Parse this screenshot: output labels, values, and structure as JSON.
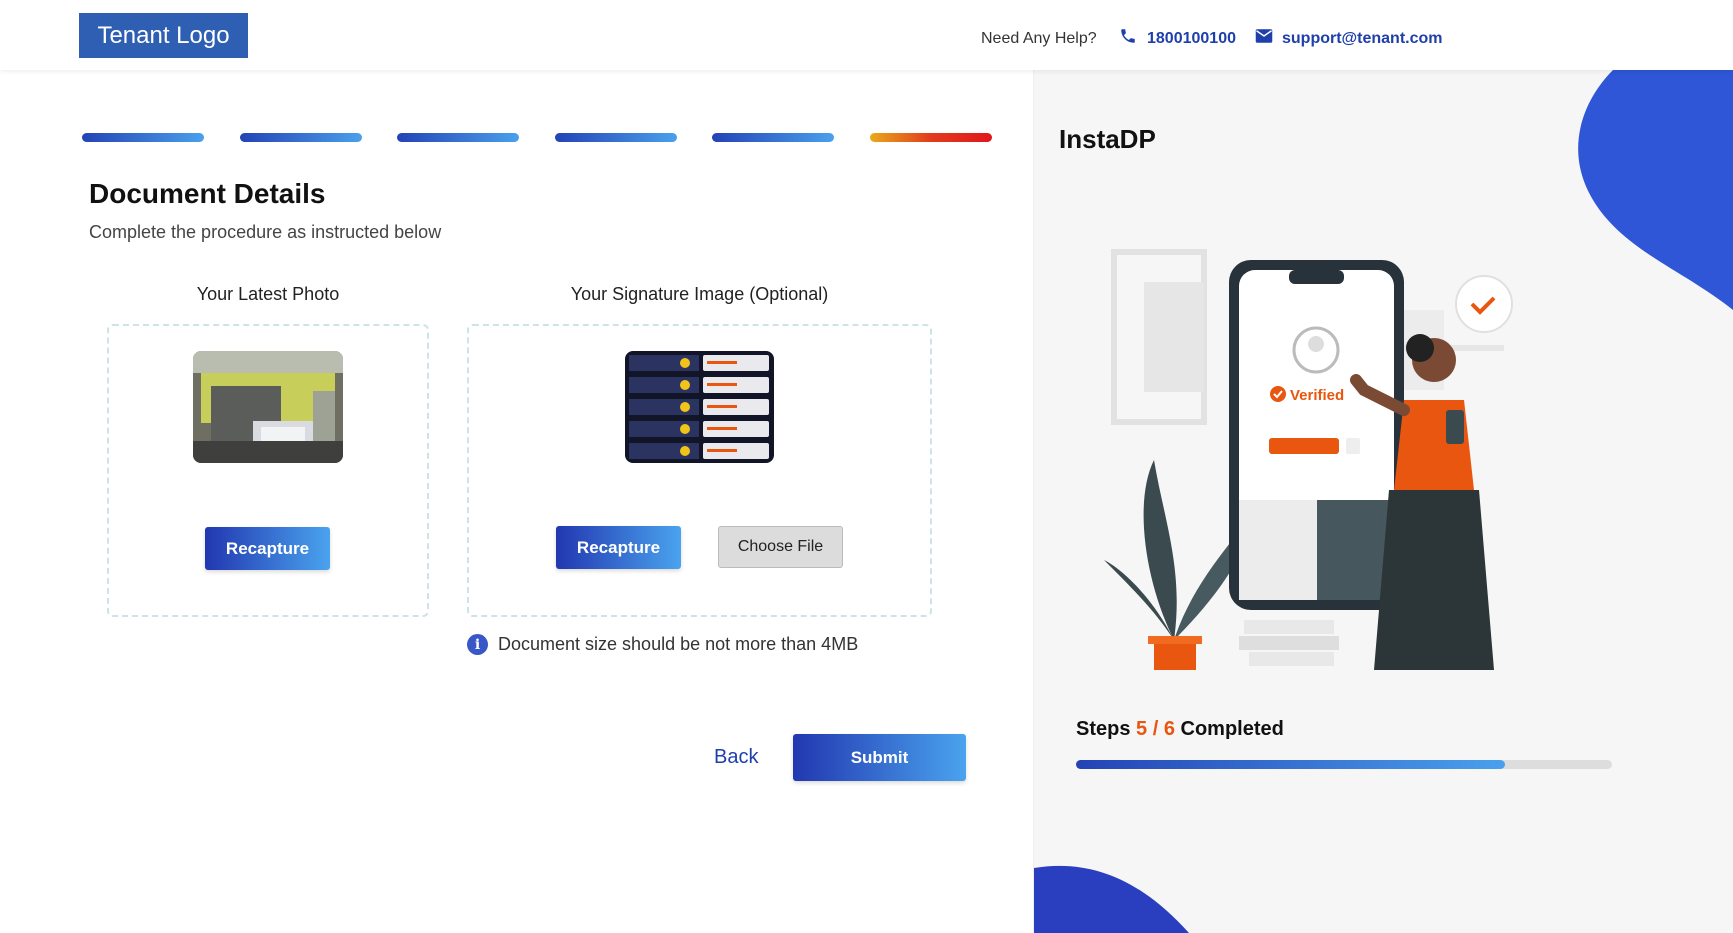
{
  "header": {
    "logo_text": "Tenant Logo",
    "help_text": "Need Any Help?",
    "phone": "1800100100",
    "email": "support@tenant.com",
    "phone_icon": "phone-icon",
    "email_icon": "mail-icon"
  },
  "stepper": {
    "total": 6,
    "current": 6
  },
  "form": {
    "title": "Document Details",
    "subtitle": "Complete the procedure as instructed below",
    "photo": {
      "label": "Your Latest Photo",
      "recapture_label": "Recapture"
    },
    "signature": {
      "label": "Your Signature Image (Optional)",
      "recapture_label": "Recapture",
      "choose_file_label": "Choose File"
    },
    "note": "Document size should be not more than 4MB",
    "back_label": "Back",
    "submit_label": "Submit"
  },
  "side_panel": {
    "app_name": "InstaDP",
    "verified_text": "Verified",
    "steps_prefix": "Steps",
    "steps_value": "5 / 6",
    "steps_suffix": "Completed",
    "progress_fraction": 0.8
  },
  "colors": {
    "brand_blue": "#2f5fb3",
    "accent_orange": "#e8560f",
    "link_blue": "#1f3faa"
  }
}
